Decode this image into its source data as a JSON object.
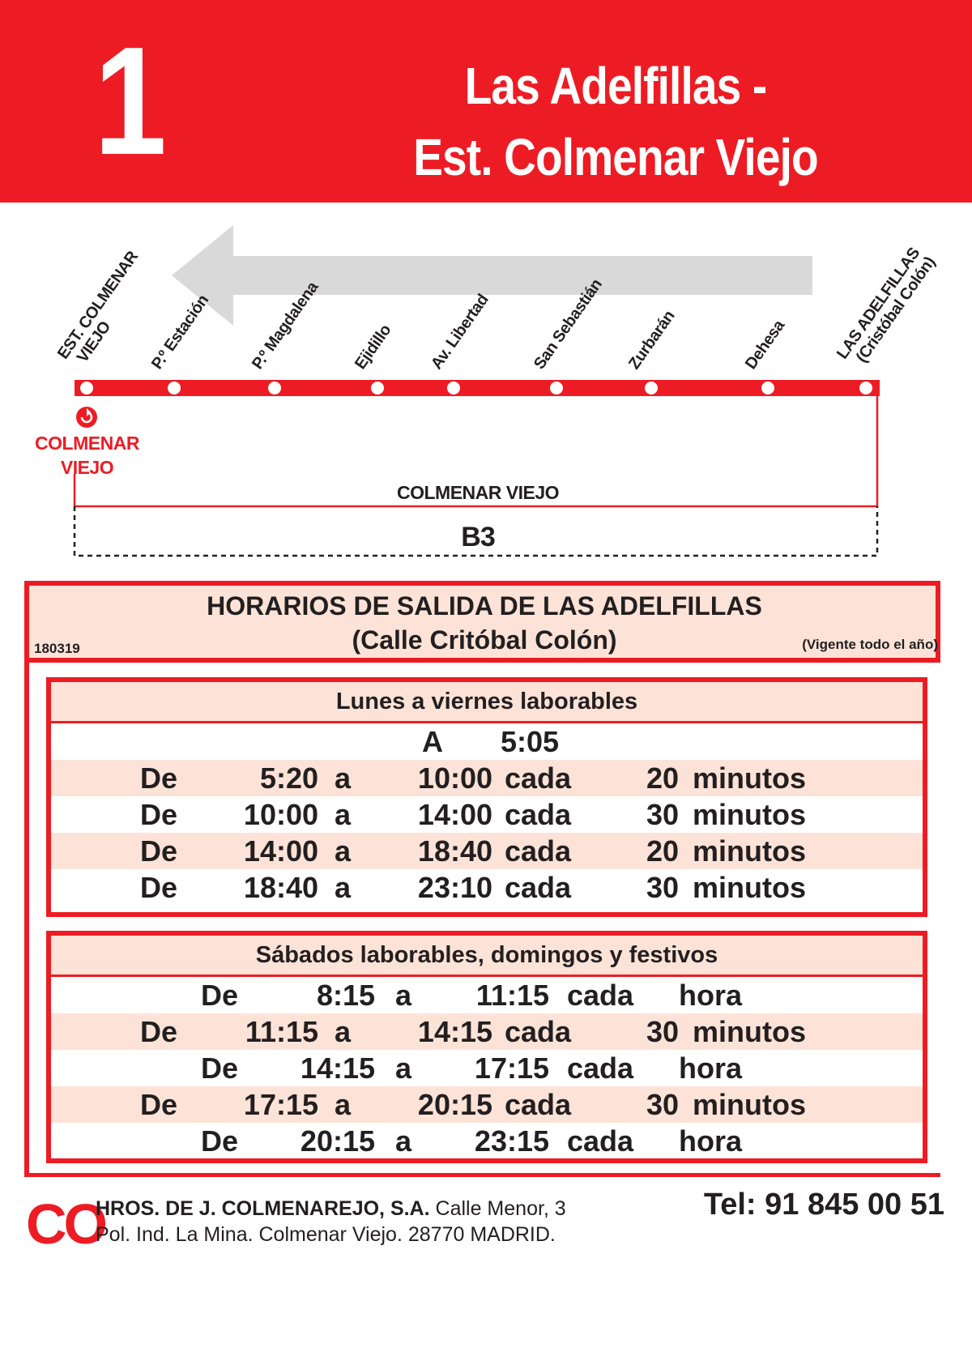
{
  "header": {
    "route_number": "1",
    "title_line1": "Las Adelfillas -",
    "title_line2": "Est. Colmenar Viejo"
  },
  "diagram": {
    "direction": "right-to-left",
    "stops": [
      {
        "label": "EST. COLMENAR\n  VIEJO"
      },
      {
        "label": "P.º Estación"
      },
      {
        "label": "P.º Magdalena"
      },
      {
        "label": "Ejidillo"
      },
      {
        "label": "Av. Libertad"
      },
      {
        "label": "San Sebastián"
      },
      {
        "label": "Zurbarán"
      },
      {
        "label": "Dehesa"
      },
      {
        "label": "LAS ADELFILLAS\n  (Cristóbal Colón)"
      }
    ],
    "interchange_label_line1": "COLMENAR",
    "interchange_label_line2": "VIEJO",
    "zone_label": "COLMENAR VIEJO",
    "zone_code": "B3",
    "colors": {
      "route": "#ed1c24",
      "arrow": "#d9d9d9"
    }
  },
  "schedule": {
    "title_line1": "HORARIOS DE SALIDA DE LAS ADELFILLAS",
    "title_line2": "(Calle Critóbal Colón)",
    "code": "180319",
    "validity": "(Vigente todo el año)",
    "weekdays": {
      "heading": "Lunes a viernes laborables",
      "first": {
        "prefix": "A",
        "time": "5:05"
      },
      "rows": [
        {
          "de": "De",
          "from": "5:20",
          "a": "a",
          "to": "10:00",
          "cada": "cada",
          "freq": "20",
          "unit": "minutos"
        },
        {
          "de": "De",
          "from": "10:00",
          "a": "a",
          "to": "14:00",
          "cada": "cada",
          "freq": "30",
          "unit": "minutos"
        },
        {
          "de": "De",
          "from": "14:00",
          "a": "a",
          "to": "18:40",
          "cada": "cada",
          "freq": "20",
          "unit": "minutos"
        },
        {
          "de": "De",
          "from": "18:40",
          "a": "a",
          "to": "23:10",
          "cada": "cada",
          "freq": "30",
          "unit": "minutos"
        }
      ]
    },
    "weekends": {
      "heading": "Sábados laborables, domingos y festivos",
      "rows": [
        {
          "style": "hourly",
          "de": "De",
          "from": "8:15",
          "a": "a",
          "to": "11:15",
          "cada": "cada",
          "unit": "hora"
        },
        {
          "style": "minutes",
          "de": "De",
          "from": "11:15",
          "a": "a",
          "to": "14:15",
          "cada": "cada",
          "freq": "30",
          "unit": "minutos"
        },
        {
          "style": "hourly",
          "de": "De",
          "from": "14:15",
          "a": "a",
          "to": "17:15",
          "cada": "cada",
          "unit": "hora"
        },
        {
          "style": "minutes",
          "de": "De",
          "from": "17:15",
          "a": "a",
          "to": "20:15",
          "cada": "cada",
          "freq": "30",
          "unit": "minutos"
        },
        {
          "style": "hourly",
          "de": "De",
          "from": "20:15",
          "a": "a",
          "to": "23:15",
          "cada": "cada",
          "unit": "hora"
        }
      ]
    }
  },
  "footer": {
    "logo": "CO",
    "company_name": "HROS. DE J. COLMENAREJO, S.A.",
    "address_line1": "Calle Menor, 3",
    "address_line2": "Pol. Ind. La Mina. Colmenar Viejo. 28770 MADRID.",
    "phone": "Tel: 91 845 00 51"
  }
}
